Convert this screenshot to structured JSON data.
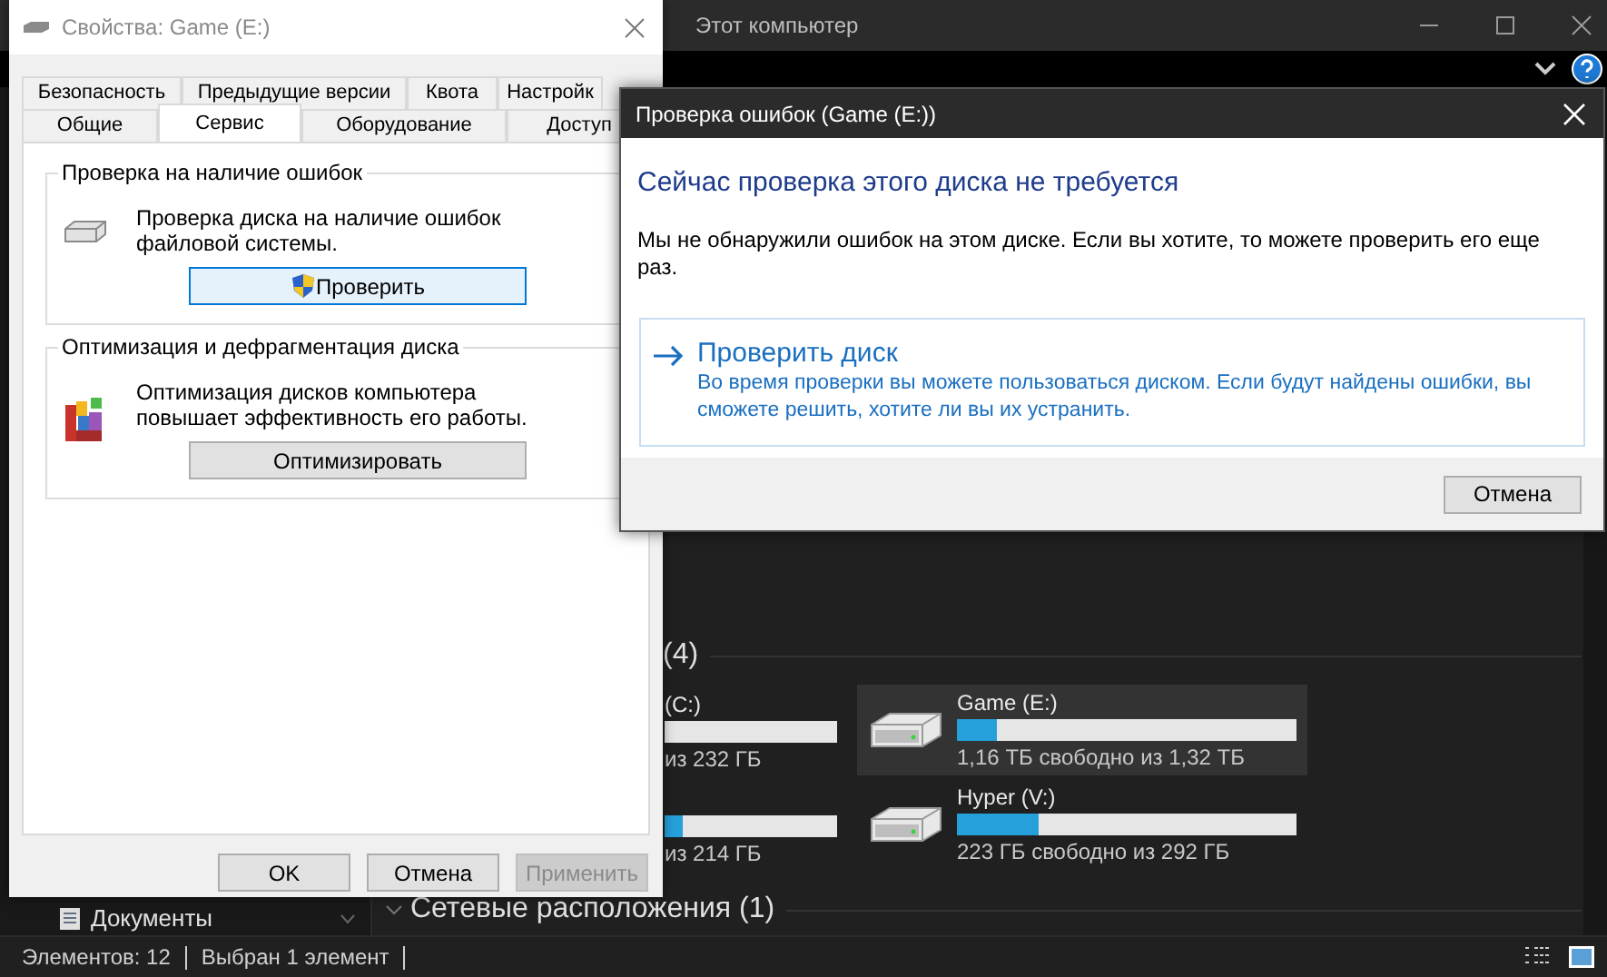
{
  "explorer": {
    "title": "Этот компьютер",
    "section": "(4)",
    "drives": [
      {
        "kind": "partial",
        "label": "(C:)",
        "free": "из 232 ГБ",
        "selected": false
      },
      {
        "kind": "partial",
        "level": 0.1,
        "free": "из 214 ГБ",
        "selected": false
      },
      {
        "kind": "full",
        "label": "Game (E:)",
        "level": 0.12,
        "free": "1,16 ТБ свободно из 1,32 ТБ",
        "selected": true
      },
      {
        "kind": "full",
        "label": "Hyper (V:)",
        "level": 0.24,
        "free": "223 ГБ свободно из 292 ГБ",
        "selected": false
      }
    ],
    "network_section": "Сетевые расположения (1)",
    "nav_item": "Документы",
    "status_bar": [
      "Элементов: 12",
      "Выбран 1 элемент"
    ]
  },
  "properties": {
    "title": "Свойства: Game (E:)",
    "tab_rows": [
      [
        {
          "label": "Безопасность",
          "selected": false
        },
        {
          "label": "Предыдущие версии",
          "selected": false
        },
        {
          "label": "Квота",
          "selected": false
        },
        {
          "label": "Настройк",
          "selected": false
        }
      ],
      [
        {
          "label": "Общие",
          "selected": false
        },
        {
          "label": "Сервис",
          "selected": true
        },
        {
          "label": "Оборудование",
          "selected": false
        },
        {
          "label": "Доступ",
          "selected": false
        }
      ]
    ],
    "groups": [
      {
        "kind": "check",
        "title": "Проверка на наличие ошибок",
        "text": "Проверка диска на наличие ошибок файловой системы.",
        "button": "Проверить"
      },
      {
        "kind": "defrag",
        "title": "Оптимизация и дефрагментация диска",
        "text": "Оптимизация дисков компьютера повышает эффективность его работы.",
        "button": "Оптимизировать"
      }
    ],
    "buttons": [
      {
        "label": "OK",
        "disabled": false
      },
      {
        "label": "Отмена",
        "disabled": false
      },
      {
        "label": "Применить",
        "disabled": true
      }
    ]
  },
  "check_dialog": {
    "title": "Проверка ошибок (Game (E:))",
    "heading": "Сейчас проверка этого диска не требуется",
    "message": "Мы не обнаружили ошибок на этом диске. Если вы хотите, то можете проверить его еще раз.",
    "command": {
      "title": "Проверить диск",
      "description": "Во время проверки вы можете пользоваться диском. Если будут найдены ошибки, вы сможете решить, хотите ли вы их устранить."
    },
    "cancel": "Отмена"
  }
}
